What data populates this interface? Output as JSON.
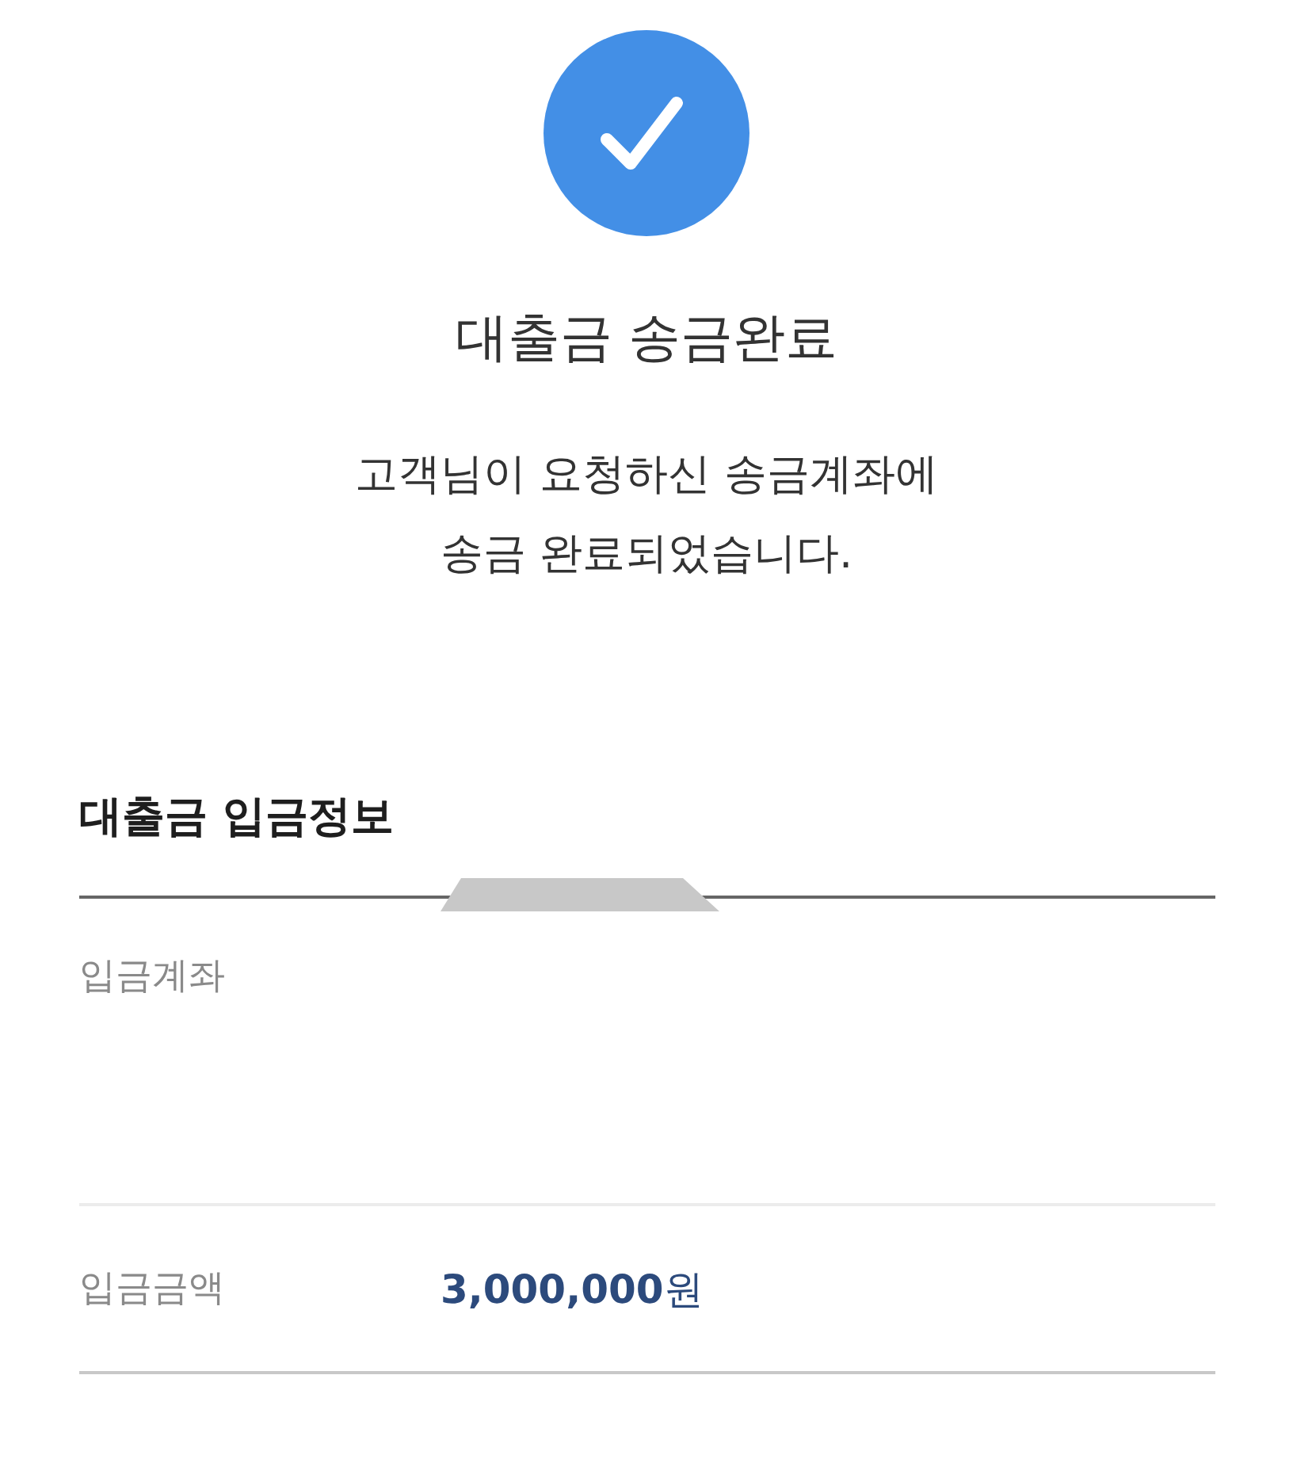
{
  "status": {
    "kind": "success",
    "title": "대출금 송금완료",
    "message_lines": [
      "고객님이 요청하신 송금계좌에",
      "송금 완료되었습니다."
    ]
  },
  "section": {
    "title": "대출금 입금정보",
    "handle": true,
    "rows": [
      {
        "label": "입금계좌"
      },
      {
        "label": "입금금액",
        "value": "**3,000,000**원"
      }
    ]
  }
}
